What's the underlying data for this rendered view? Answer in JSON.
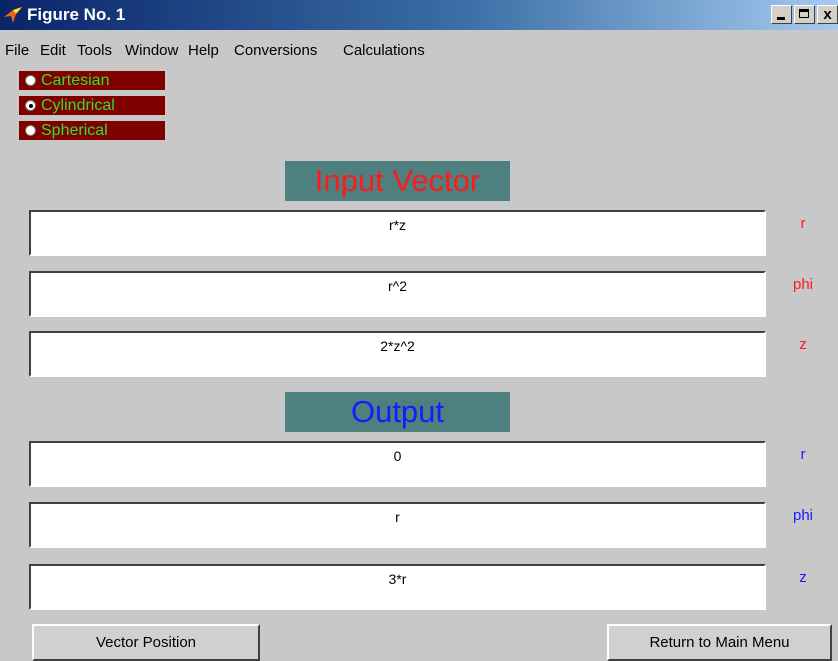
{
  "window": {
    "title": "Figure No. 1",
    "close_glyph": "x"
  },
  "menu": [
    "File",
    "Edit",
    "Tools",
    "Window",
    "Help",
    "Conversions",
    "Calculations"
  ],
  "coordinate_systems": [
    {
      "label": "Cartesian",
      "selected": false
    },
    {
      "label": "Cylindrical",
      "selected": true
    },
    {
      "label": "Spherical",
      "selected": false
    }
  ],
  "input": {
    "heading": "Input Vector",
    "fields": [
      {
        "value": "r*z",
        "label": "r"
      },
      {
        "value": "r^2",
        "label": "phi"
      },
      {
        "value": "2*z^2",
        "label": "z"
      }
    ]
  },
  "output": {
    "heading": "Output",
    "fields": [
      {
        "value": "0",
        "label": "r"
      },
      {
        "value": "r",
        "label": "phi"
      },
      {
        "value": "3*r",
        "label": "z"
      }
    ]
  },
  "buttons": {
    "vector_position": "Vector Position",
    "return_main": "Return to Main Menu"
  },
  "colors": {
    "input_text": "#ff1a1a",
    "output_text": "#1a1aff",
    "radio_bg": "#800000",
    "radio_text": "#33dd33",
    "heading_bg": "#4e8080"
  }
}
